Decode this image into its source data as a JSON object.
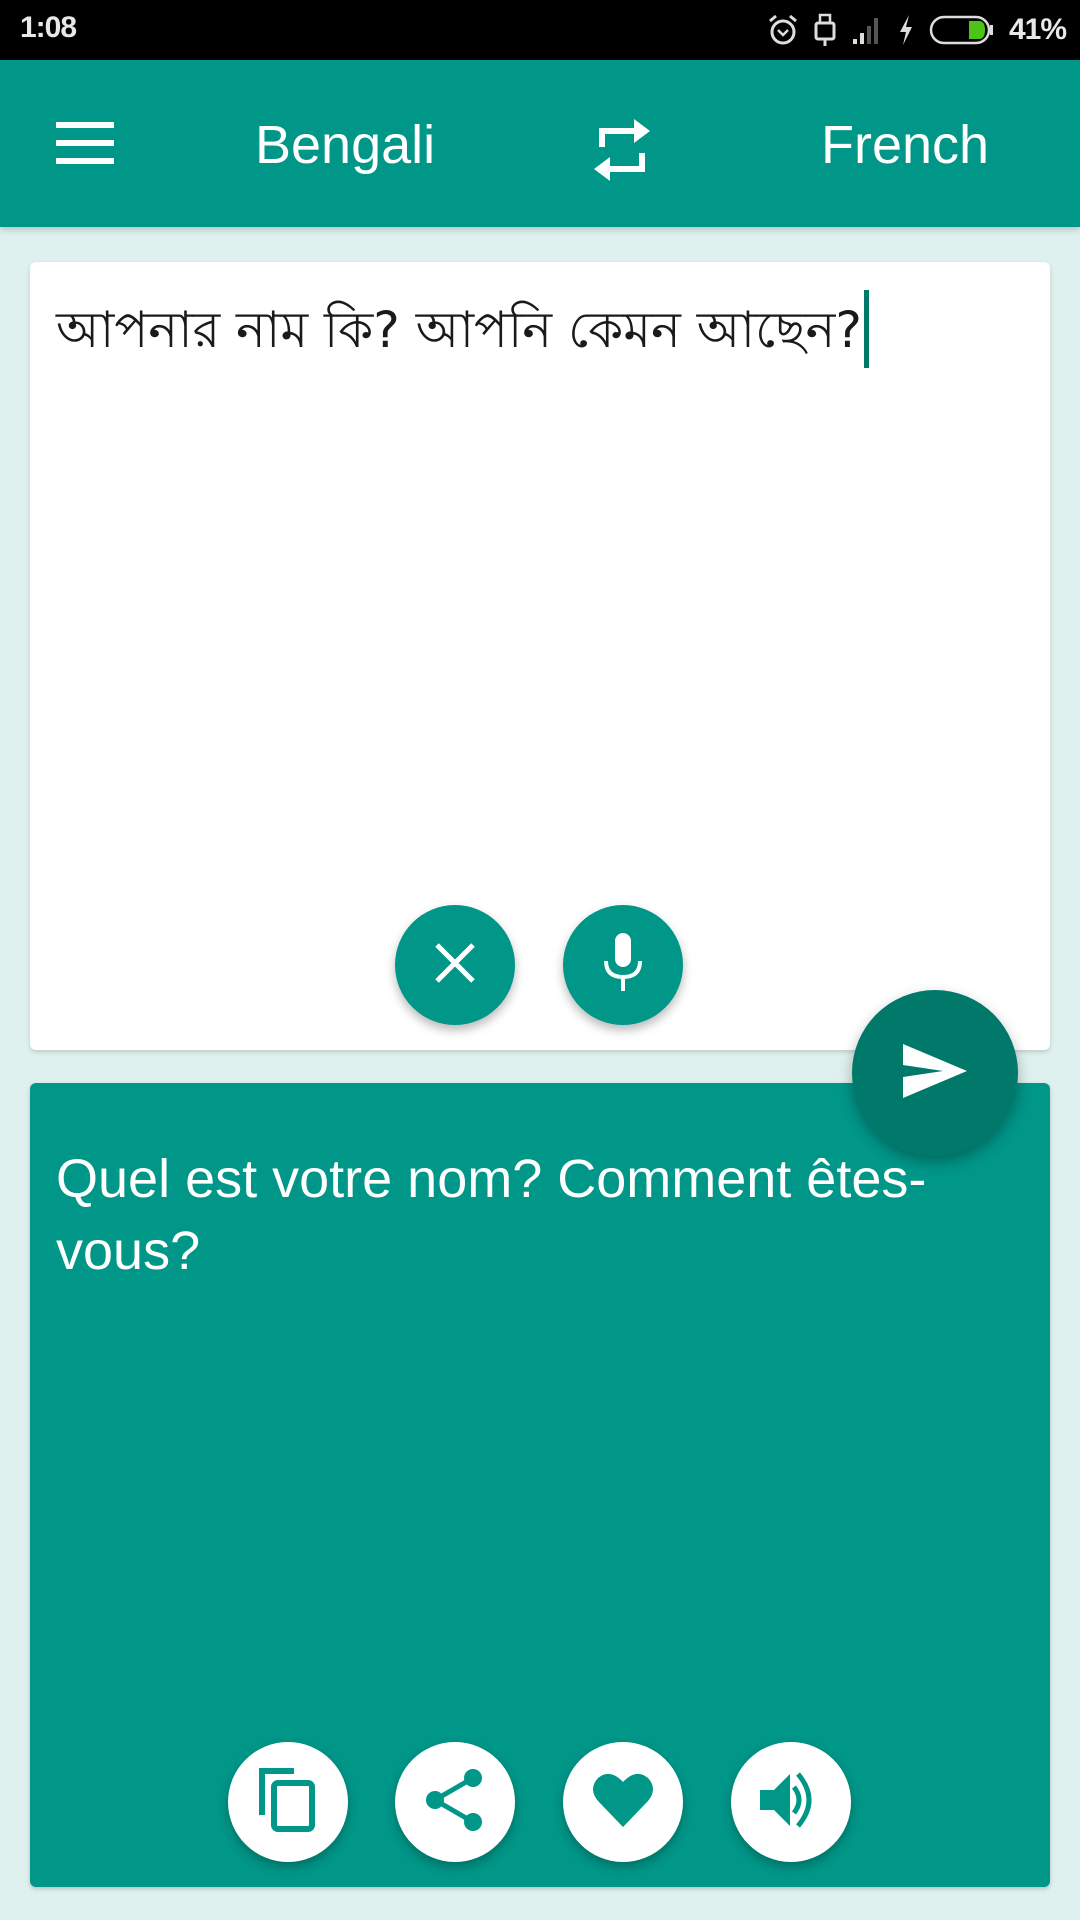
{
  "status_bar": {
    "time": "1:08",
    "icons": [
      "alarm-icon",
      "usb-icon",
      "signal-icon",
      "charging-icon",
      "battery-icon"
    ],
    "battery_percent": "41%",
    "battery_level": 0.41,
    "battery_color": "#4cc417"
  },
  "app_bar": {
    "menu_icon": "hamburger-menu-icon",
    "source_language": "Bengali",
    "swap_icon": "swap-languages-icon",
    "target_language": "French",
    "color": "#009688"
  },
  "input": {
    "text": "আপনার নাম কি? আপনি কেমন আছেন?",
    "clear_icon": "close-icon",
    "mic_icon": "microphone-icon"
  },
  "send": {
    "icon": "send-icon",
    "color": "#00796b"
  },
  "output": {
    "text": "Quel est votre nom? Comment êtes-vous?",
    "actions": [
      {
        "name": "copy",
        "icon": "copy-icon"
      },
      {
        "name": "share",
        "icon": "share-icon"
      },
      {
        "name": "favorite",
        "icon": "heart-icon"
      },
      {
        "name": "speak",
        "icon": "speaker-icon"
      }
    ]
  },
  "colors": {
    "background": "#dff1ee",
    "accent": "#009688",
    "accent_dark": "#00796b"
  }
}
